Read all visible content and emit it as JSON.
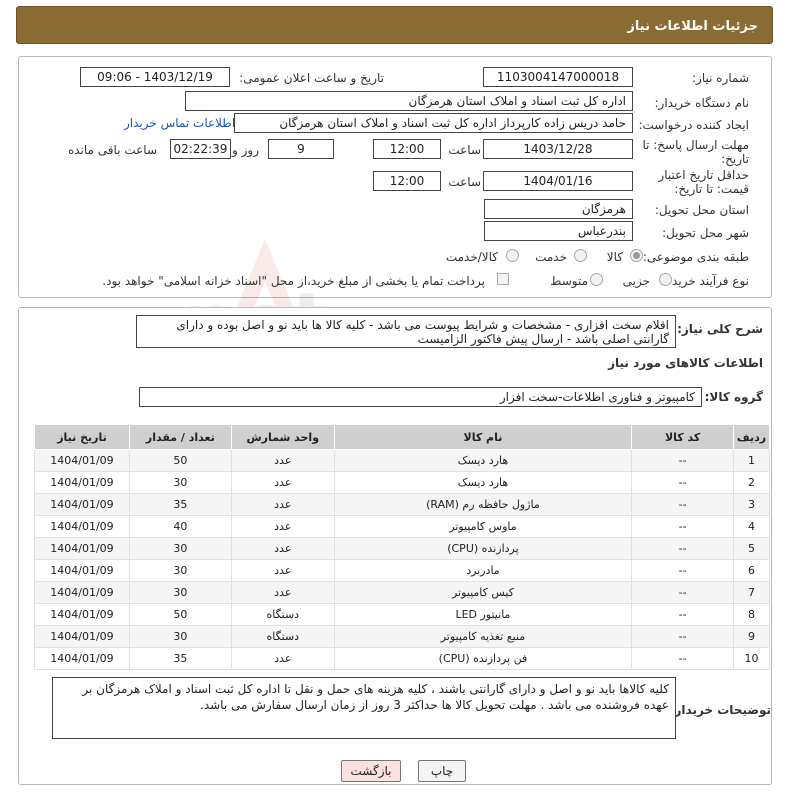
{
  "header": {
    "title": "جزئیات اطلاعات نیاز"
  },
  "form": {
    "need_number_label": "شماره نیاز:",
    "need_number": "1103004147000018",
    "announce_label": "تاریخ و ساعت اعلان عمومی:",
    "announce_value": "1403/12/19 - 09:06",
    "buyer_label": "نام دستگاه خریدار:",
    "buyer_value": "اداره کل ثبت اسناد و املاک استان هرمزگان",
    "creator_label": "ایجاد کننده درخواست:",
    "creator_value": "حامد دریس زاده کارپرداز اداره کل ثبت اسناد و املاک استان هرمزگان",
    "contact_link": "اطلاعات تماس خریدار",
    "deadline_label": "مهلت ارسال پاسخ: تا تاریخ:",
    "deadline_date": "1403/12/28",
    "time_label": "ساعت",
    "deadline_time": "12:00",
    "days_value": "9",
    "days_label": "روز و",
    "remaining_value": "02:22:39",
    "remaining_label": "ساعت باقی مانده",
    "validity_label": "حداقل تاریخ اعتبار قیمت: تا تاریخ:",
    "validity_date": "1404/01/16",
    "validity_time": "12:00",
    "province_label": "استان محل تحویل:",
    "province_value": "هرمزگان",
    "city_label": "شهر محل تحویل:",
    "city_value": "بندرعباس",
    "category_label": "طبقه بندی موضوعی:",
    "category_options": [
      "کالا",
      "خدمت",
      "کالا/خدمت"
    ],
    "process_label": "نوع فرآیند خرید :",
    "process_options": [
      "جزیی",
      "متوسط"
    ],
    "payment_text": "پرداخت تمام یا بخشی از مبلغ خرید،از محل \"اسناد خزانه اسلامی\" خواهد بود."
  },
  "details": {
    "summary_label": "شرح کلی نیاز:",
    "summary_text": "اقلام سخت افزاری - مشخصات و شرایط پیوست می باشد - کلیه کالا ها باید نو و اصل بوده و دارای گارانتی اصلی باشد - ارسال پیش فاکتور الزامیست",
    "goods_info_title": "اطلاعات کالاهای مورد نیاز",
    "group_label": "گروه کالا:",
    "group_value": "کامپیوتر و فناوری اطلاعات-سخت افزار",
    "table_headers": [
      "ردیف",
      "کد کالا",
      "نام کالا",
      "واحد شمارش",
      "تعداد / مقدار",
      "تاریخ نیاز"
    ],
    "rows": [
      [
        "1",
        "--",
        "هارد دیسک",
        "عدد",
        "50",
        "1404/01/09"
      ],
      [
        "2",
        "--",
        "هارد دیسک",
        "عدد",
        "30",
        "1404/01/09"
      ],
      [
        "3",
        "--",
        "ماژول حافظه رم (RAM)",
        "عدد",
        "35",
        "1404/01/09"
      ],
      [
        "4",
        "--",
        "ماوس کامپیوتر",
        "عدد",
        "40",
        "1404/01/09"
      ],
      [
        "5",
        "--",
        "پردازنده (CPU)",
        "عدد",
        "30",
        "1404/01/09"
      ],
      [
        "6",
        "--",
        "مادربرد",
        "عدد",
        "30",
        "1404/01/09"
      ],
      [
        "7",
        "--",
        "کیس کامپیوتر",
        "عدد",
        "30",
        "1404/01/09"
      ],
      [
        "8",
        "--",
        "مانیتور LED",
        "دستگاه",
        "50",
        "1404/01/09"
      ],
      [
        "9",
        "--",
        "منبع تغذیه کامپیوتر",
        "دستگاه",
        "30",
        "1404/01/09"
      ],
      [
        "10",
        "--",
        "فن پردازنده (CPU)",
        "عدد",
        "35",
        "1404/01/09"
      ]
    ],
    "buyer_notes_label": "توضیحات خریدار:",
    "buyer_notes_text": "کلیه کالاها باید نو و اصل و دارای گارانتی باشند ، کلیه هزینه های حمل و نقل تا اداره کل ثبت اسناد و املاک هرمزگان بر عهده فروشنده می باشد . مهلت تحویل کالا ها حداکثر 3 روز از زمان ارسال سفارش می باشد."
  },
  "buttons": {
    "print": "چاپ",
    "back": "بازگشت"
  },
  "watermark": {
    "text": "AriaTender.net"
  },
  "colors": {
    "header": "#8b6b34",
    "link": "#1a55b8",
    "back_button": "#fbe1e1"
  }
}
